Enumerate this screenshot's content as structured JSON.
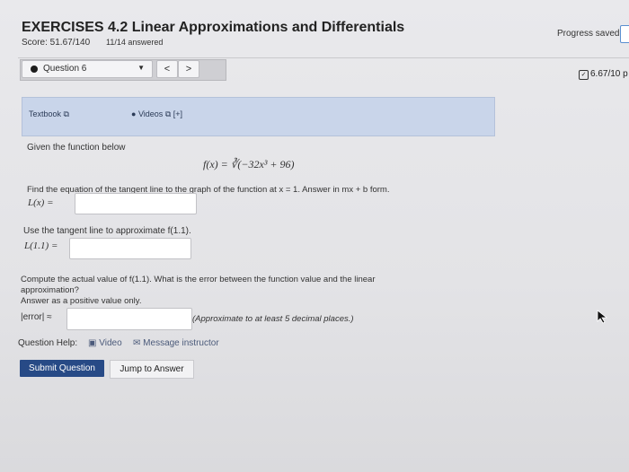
{
  "header": {
    "title": "EXERCISES 4.2 Linear Approximations and Differentials",
    "score": "Score: 51.67/140",
    "answered": "11/14 answered",
    "progress": "Progress saved"
  },
  "question_nav": {
    "selected": "Question 6",
    "prev": "<",
    "next": ">",
    "points": "6.67/10 p"
  },
  "resources": {
    "textbook": "Textbook",
    "videos": "Videos",
    "videos_expand": "[+]"
  },
  "problem": {
    "given": "Given the function below",
    "function": "f(x) = ∛(−32x³ + 96)",
    "part1_prompt": "Find the equation of the tangent line to the graph of the function at x = 1. Answer in mx + b form.",
    "part1_label": "L(x) =",
    "part1_value": "",
    "part2_prompt": "Use the tangent line to approximate f(1.1).",
    "part2_label": "L(1.1) =",
    "part2_value": "",
    "part3_prompt_line1": "Compute the actual value of f(1.1). What is the error between the function value and the linear",
    "part3_prompt_line2": "approximation?",
    "part3_prompt_line3": "Answer as a positive value only.",
    "part3_label": "|error| ≈",
    "part3_value": "",
    "part3_hint": "(Approximate to at least 5 decimal places.)"
  },
  "help": {
    "label": "Question Help:",
    "video": "Video",
    "message": "Message instructor"
  },
  "actions": {
    "submit": "Submit Question",
    "jump": "Jump to Answer"
  }
}
